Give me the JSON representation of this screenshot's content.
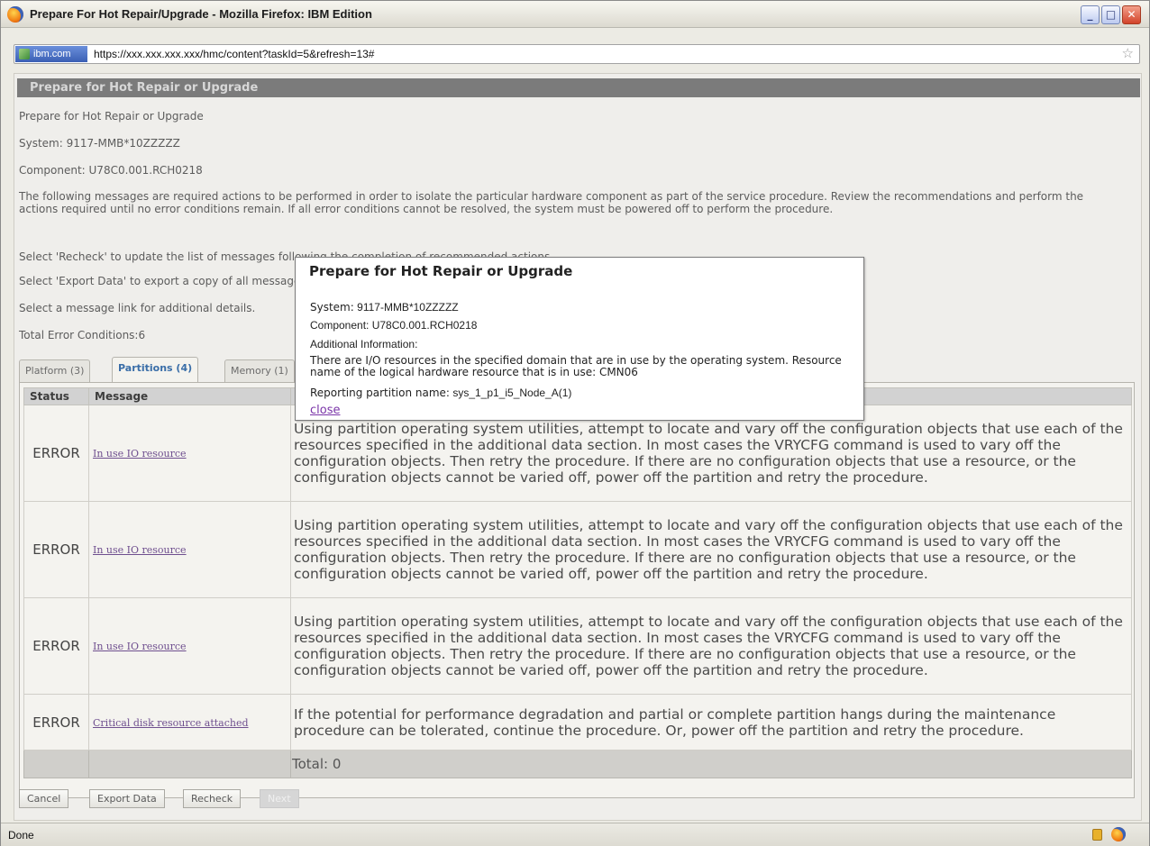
{
  "window": {
    "title": "Prepare For Hot Repair/Upgrade - Mozilla Firefox: IBM Edition",
    "minimize_glyph": "_",
    "maximize_glyph": "□",
    "close_glyph": "✕"
  },
  "address_bar": {
    "site_badge": "ibm.com",
    "url": "https://xxx.xxx.xxx.xxx/hmc/content?taskId=5&refresh=13#",
    "star_glyph": "☆"
  },
  "page": {
    "heading": "Prepare for Hot Repair or Upgrade",
    "subtitle": "Prepare for Hot Repair or Upgrade",
    "system": "System: 9117-MMB*10ZZZZZ",
    "component": "Component: U78C0.001.RCH0218",
    "description": "The following messages are required actions to be performed in order to isolate the particular hardware component as part of the service procedure. Review the recommendations and perform the actions required until no error conditions remain. If all error conditions cannot be resolved, the system must be powered off to perform the procedure.",
    "recheck_hint": "Select 'Recheck' to update the list of messages following the completion of recommended actions.",
    "export_hint": "Select 'Export Data' to export a copy of all messages.",
    "link_hint": "Select a message link for additional details.",
    "total_errors": "Total Error Conditions:6"
  },
  "tabs": [
    {
      "label": "Platform (3)"
    },
    {
      "label": "Partitions (4)"
    },
    {
      "label": "Memory (1)"
    }
  ],
  "table": {
    "headers": [
      "Status",
      "Message",
      ""
    ],
    "rows": [
      {
        "status": "ERROR",
        "message": "In use IO resource",
        "recommendation": "Using partition operating system utilities, attempt to locate and vary off the configuration objects that use each of the resources specified in the additional data section. In most cases the VRYCFG command is used to vary off the configuration objects. Then retry the procedure. If there are no configuration objects that use a resource, or the configuration objects cannot be varied off, power off the partition and retry the procedure."
      },
      {
        "status": "ERROR",
        "message": "In use IO resource",
        "recommendation": "Using partition operating system utilities, attempt to locate and vary off the configuration objects that use each of the resources specified in the additional data section. In most cases the VRYCFG command is used to vary off the configuration objects. Then retry the procedure. If there are no configuration objects that use a resource, or the configuration objects cannot be varied off, power off the partition and retry the procedure."
      },
      {
        "status": "ERROR",
        "message": "In use IO resource",
        "recommendation": "Using partition operating system utilities, attempt to locate and vary off the configuration objects that use each of the resources specified in the additional data section. In most cases the VRYCFG command is used to vary off the configuration objects. Then retry the procedure. If there are no configuration objects that use a resource, or the configuration objects cannot be varied off, power off the partition and retry the procedure."
      },
      {
        "status": "ERROR",
        "message": "Critical disk resource attached",
        "recommendation": "If the potential for performance degradation and partial or complete partition hangs during the maintenance procedure can be tolerated, continue the procedure. Or, power off the partition and retry the procedure."
      }
    ],
    "footer_total": "Total: 0"
  },
  "buttons": {
    "cancel": "Cancel",
    "export": "Export Data",
    "recheck": "Recheck",
    "next": "Next"
  },
  "status_bar": {
    "text": "Done"
  },
  "popup": {
    "title": "Prepare for Hot Repair or Upgrade",
    "system_label": "System:",
    "system_value": "9117-MMB*10ZZZZZ",
    "component": "Component: U78C0.001.RCH0218",
    "additional_label": "Additional Information:",
    "info": "There are I/O resources in the specified domain that are in use by the operating system. Resource name of the logical hardware resource that is in use: CMN06",
    "partition_label": "Reporting partition name:",
    "partition_value": "sys_1_p1_i5_Node_A(1)",
    "close_label": "close"
  }
}
